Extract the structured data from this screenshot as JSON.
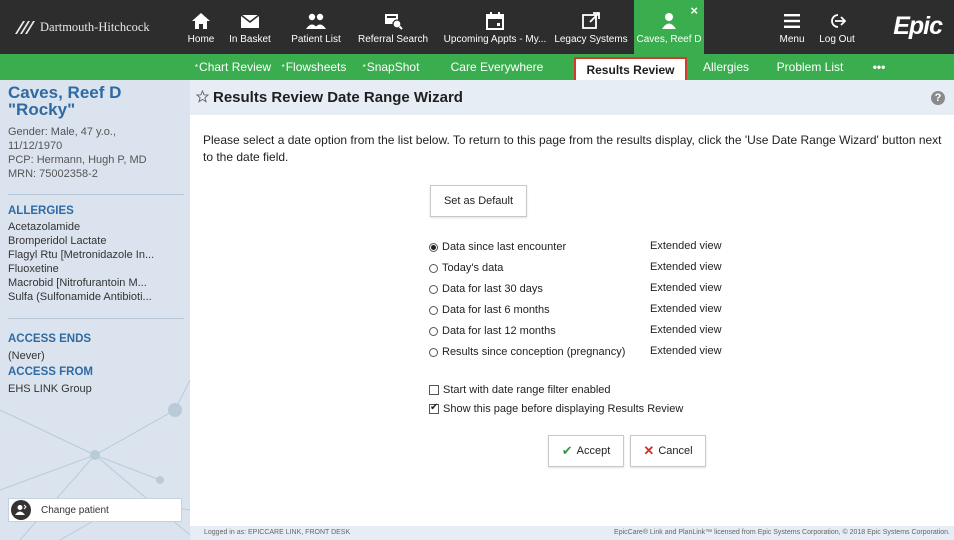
{
  "header": {
    "org_name": "Dartmouth-Hitchcock",
    "brand": "Epic",
    "tabs": [
      {
        "label": "Home",
        "icon": "home-icon"
      },
      {
        "label": "In Basket",
        "icon": "mail-icon"
      },
      {
        "label": "Patient List",
        "icon": "patient-list-icon"
      },
      {
        "label": "Referral Search",
        "icon": "referral-search-icon"
      },
      {
        "label": "Upcoming Appts - My...",
        "icon": "calendar-icon"
      },
      {
        "label": "Legacy Systems",
        "icon": "external-link-icon"
      },
      {
        "label": "Caves, Reef D",
        "icon": "person-icon"
      },
      {
        "label": "Menu",
        "icon": "menu-icon"
      },
      {
        "label": "Log Out",
        "icon": "logout-icon"
      }
    ]
  },
  "activity_tabs": [
    {
      "label": "Chart Review",
      "starred": true
    },
    {
      "label": "Flowsheets",
      "starred": true
    },
    {
      "label": "SnapShot",
      "starred": true
    },
    {
      "label": "Care Everywhere",
      "starred": false
    },
    {
      "label": "Results Review",
      "starred": false
    },
    {
      "label": "Allergies",
      "starred": false
    },
    {
      "label": "Problem List",
      "starred": false
    },
    {
      "label": "•••",
      "starred": false
    }
  ],
  "patient": {
    "name": "Caves, Reef D",
    "nickname": "\"Rocky\"",
    "gender_age": "Gender: Male, 47 y.o.,",
    "dob": "11/12/1970",
    "pcp": "PCP: Hermann, Hugh P, MD",
    "mrn": "MRN: 75002358-2",
    "allergies_header": "ALLERGIES",
    "allergies": [
      "Acetazolamide",
      "Bromperidol Lactate",
      "Flagyl Rtu [Metronidazole In...",
      "Fluoxetine",
      "Macrobid [Nitrofurantoin M...",
      "Sulfa (Sulfonamide Antibioti..."
    ],
    "access_ends_header": "ACCESS ENDS",
    "access_ends_value": "(Never)",
    "access_from_header": "ACCESS FROM",
    "access_from_value": "EHS LINK Group",
    "change_patient": "Change patient"
  },
  "wizard": {
    "title": "Results Review Date Range Wizard",
    "help": "?",
    "instructions": "Please select a date option from the list below. To return to this page from the results display, click the 'Use Date Range Wizard' button next to the date field.",
    "set_default": "Set as Default",
    "options": [
      {
        "label": "Data since last encounter",
        "view": "Extended view",
        "selected": true
      },
      {
        "label": "Today's data",
        "view": "Extended view",
        "selected": false
      },
      {
        "label": "Data for last 30 days",
        "view": "Extended view",
        "selected": false
      },
      {
        "label": "Data for last 6 months",
        "view": "Extended view",
        "selected": false
      },
      {
        "label": "Data for last 12 months",
        "view": "Extended view",
        "selected": false
      },
      {
        "label": "Results since conception (pregnancy)",
        "view": "Extended view",
        "selected": false
      }
    ],
    "filter_checkbox": {
      "label": "Start with date range filter enabled",
      "checked": false
    },
    "show_checkbox": {
      "label": "Show this page before displaying Results Review",
      "checked": true
    },
    "accept": "Accept",
    "cancel": "Cancel"
  },
  "status": {
    "left": "Logged in as: EPICCARE LINK, FRONT DESK",
    "right": "EpicCare® Link and PlanLink™ licensed from Epic Systems Corporation, © 2018 Epic Systems Corporation."
  },
  "colors": {
    "header_bg": "#2d2d2d",
    "accent_green": "#3aae4e",
    "sidebar_bg": "#dbe4ee",
    "patient_blue": "#2f6aa3",
    "active_tab_border": "#d23a2e"
  }
}
